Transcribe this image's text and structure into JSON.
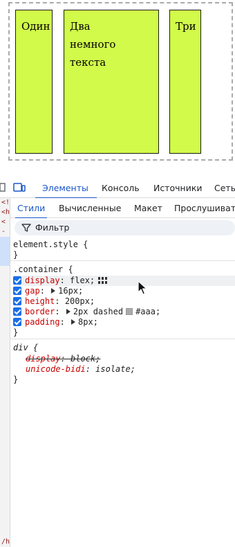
{
  "preview": {
    "boxes": [
      {
        "text": "Один"
      },
      {
        "line1": "Два",
        "line2": "немного текста"
      },
      {
        "text": "Три"
      }
    ]
  },
  "devtools": {
    "tabs": [
      "Элементы",
      "Консоль",
      "Источники",
      "Сеть"
    ],
    "subtabs": [
      "Стили",
      "Вычисленные",
      "Макет",
      "Прослушивате"
    ],
    "filter_placeholder": "Фильтр",
    "dom_strip": [
      "<!D",
      "<ht",
      "<",
      "-",
      "",
      "",
      "",
      "",
      "",
      "",
      "",
      "",
      "",
      "",
      "",
      "",
      "",
      "",
      "",
      "",
      "",
      "",
      "",
      "",
      "",
      "",
      "",
      "",
      "",
      "",
      "",
      "",
      "",
      "",
      "",
      "/h"
    ],
    "styles": {
      "element_style": {
        "selector": "element.style {",
        "close": "}"
      },
      "container": {
        "selector": ".container {",
        "decls": [
          {
            "prop": "display",
            "value": "flex;",
            "has_flex_icon": true
          },
          {
            "prop": "gap",
            "value": "16px;",
            "has_triangle": true
          },
          {
            "prop": "height",
            "value": "200px;"
          },
          {
            "prop": "border",
            "value_pre": "2px dashed",
            "value_post": "#aaa;",
            "has_triangle": true,
            "swatch": "#aaaaaa"
          },
          {
            "prop": "padding",
            "value": "8px;",
            "has_triangle": true
          }
        ],
        "close": "}"
      },
      "div_rule": {
        "selector": "div {",
        "decls": [
          {
            "prop": "display",
            "value": "block;",
            "strikethrough": true
          },
          {
            "prop": "unicode-bidi",
            "value": "isolate;"
          }
        ],
        "close": "}"
      }
    }
  },
  "colors": {
    "box_fill": "#d1fa4a",
    "accent": "#1a56c6",
    "checkbox": "#1a6fe8",
    "prop_red": "#c80000"
  }
}
